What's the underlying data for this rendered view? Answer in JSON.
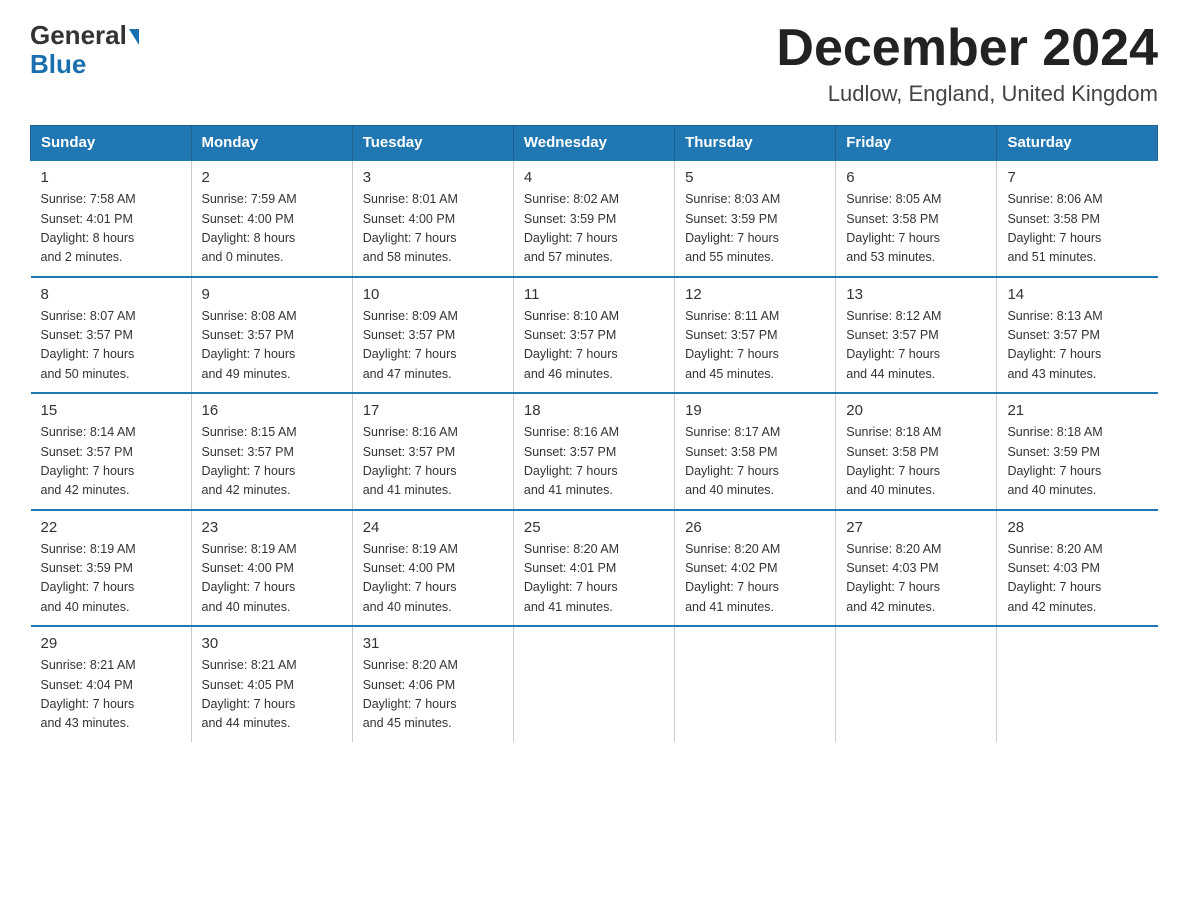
{
  "header": {
    "logo_general": "General",
    "logo_blue": "Blue",
    "title": "December 2024",
    "subtitle": "Ludlow, England, United Kingdom"
  },
  "columns": [
    "Sunday",
    "Monday",
    "Tuesday",
    "Wednesday",
    "Thursday",
    "Friday",
    "Saturday"
  ],
  "weeks": [
    [
      {
        "day": "1",
        "info": "Sunrise: 7:58 AM\nSunset: 4:01 PM\nDaylight: 8 hours\nand 2 minutes."
      },
      {
        "day": "2",
        "info": "Sunrise: 7:59 AM\nSunset: 4:00 PM\nDaylight: 8 hours\nand 0 minutes."
      },
      {
        "day": "3",
        "info": "Sunrise: 8:01 AM\nSunset: 4:00 PM\nDaylight: 7 hours\nand 58 minutes."
      },
      {
        "day": "4",
        "info": "Sunrise: 8:02 AM\nSunset: 3:59 PM\nDaylight: 7 hours\nand 57 minutes."
      },
      {
        "day": "5",
        "info": "Sunrise: 8:03 AM\nSunset: 3:59 PM\nDaylight: 7 hours\nand 55 minutes."
      },
      {
        "day": "6",
        "info": "Sunrise: 8:05 AM\nSunset: 3:58 PM\nDaylight: 7 hours\nand 53 minutes."
      },
      {
        "day": "7",
        "info": "Sunrise: 8:06 AM\nSunset: 3:58 PM\nDaylight: 7 hours\nand 51 minutes."
      }
    ],
    [
      {
        "day": "8",
        "info": "Sunrise: 8:07 AM\nSunset: 3:57 PM\nDaylight: 7 hours\nand 50 minutes."
      },
      {
        "day": "9",
        "info": "Sunrise: 8:08 AM\nSunset: 3:57 PM\nDaylight: 7 hours\nand 49 minutes."
      },
      {
        "day": "10",
        "info": "Sunrise: 8:09 AM\nSunset: 3:57 PM\nDaylight: 7 hours\nand 47 minutes."
      },
      {
        "day": "11",
        "info": "Sunrise: 8:10 AM\nSunset: 3:57 PM\nDaylight: 7 hours\nand 46 minutes."
      },
      {
        "day": "12",
        "info": "Sunrise: 8:11 AM\nSunset: 3:57 PM\nDaylight: 7 hours\nand 45 minutes."
      },
      {
        "day": "13",
        "info": "Sunrise: 8:12 AM\nSunset: 3:57 PM\nDaylight: 7 hours\nand 44 minutes."
      },
      {
        "day": "14",
        "info": "Sunrise: 8:13 AM\nSunset: 3:57 PM\nDaylight: 7 hours\nand 43 minutes."
      }
    ],
    [
      {
        "day": "15",
        "info": "Sunrise: 8:14 AM\nSunset: 3:57 PM\nDaylight: 7 hours\nand 42 minutes."
      },
      {
        "day": "16",
        "info": "Sunrise: 8:15 AM\nSunset: 3:57 PM\nDaylight: 7 hours\nand 42 minutes."
      },
      {
        "day": "17",
        "info": "Sunrise: 8:16 AM\nSunset: 3:57 PM\nDaylight: 7 hours\nand 41 minutes."
      },
      {
        "day": "18",
        "info": "Sunrise: 8:16 AM\nSunset: 3:57 PM\nDaylight: 7 hours\nand 41 minutes."
      },
      {
        "day": "19",
        "info": "Sunrise: 8:17 AM\nSunset: 3:58 PM\nDaylight: 7 hours\nand 40 minutes."
      },
      {
        "day": "20",
        "info": "Sunrise: 8:18 AM\nSunset: 3:58 PM\nDaylight: 7 hours\nand 40 minutes."
      },
      {
        "day": "21",
        "info": "Sunrise: 8:18 AM\nSunset: 3:59 PM\nDaylight: 7 hours\nand 40 minutes."
      }
    ],
    [
      {
        "day": "22",
        "info": "Sunrise: 8:19 AM\nSunset: 3:59 PM\nDaylight: 7 hours\nand 40 minutes."
      },
      {
        "day": "23",
        "info": "Sunrise: 8:19 AM\nSunset: 4:00 PM\nDaylight: 7 hours\nand 40 minutes."
      },
      {
        "day": "24",
        "info": "Sunrise: 8:19 AM\nSunset: 4:00 PM\nDaylight: 7 hours\nand 40 minutes."
      },
      {
        "day": "25",
        "info": "Sunrise: 8:20 AM\nSunset: 4:01 PM\nDaylight: 7 hours\nand 41 minutes."
      },
      {
        "day": "26",
        "info": "Sunrise: 8:20 AM\nSunset: 4:02 PM\nDaylight: 7 hours\nand 41 minutes."
      },
      {
        "day": "27",
        "info": "Sunrise: 8:20 AM\nSunset: 4:03 PM\nDaylight: 7 hours\nand 42 minutes."
      },
      {
        "day": "28",
        "info": "Sunrise: 8:20 AM\nSunset: 4:03 PM\nDaylight: 7 hours\nand 42 minutes."
      }
    ],
    [
      {
        "day": "29",
        "info": "Sunrise: 8:21 AM\nSunset: 4:04 PM\nDaylight: 7 hours\nand 43 minutes."
      },
      {
        "day": "30",
        "info": "Sunrise: 8:21 AM\nSunset: 4:05 PM\nDaylight: 7 hours\nand 44 minutes."
      },
      {
        "day": "31",
        "info": "Sunrise: 8:20 AM\nSunset: 4:06 PM\nDaylight: 7 hours\nand 45 minutes."
      },
      {
        "day": "",
        "info": ""
      },
      {
        "day": "",
        "info": ""
      },
      {
        "day": "",
        "info": ""
      },
      {
        "day": "",
        "info": ""
      }
    ]
  ]
}
